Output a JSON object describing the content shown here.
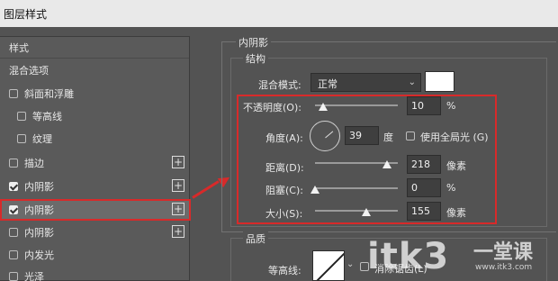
{
  "dialog": {
    "title": "图层样式"
  },
  "styles_list": {
    "header_label": "样式",
    "blend_options_label": "混合选项",
    "items": [
      {
        "label": "斜面和浮雕",
        "checked": false,
        "indent": false,
        "has_plus": false
      },
      {
        "label": "等高线",
        "checked": false,
        "indent": true,
        "has_plus": false
      },
      {
        "label": "纹理",
        "checked": false,
        "indent": true,
        "has_plus": false
      },
      {
        "label": "描边",
        "checked": false,
        "indent": false,
        "has_plus": true
      },
      {
        "label": "内阴影",
        "checked": true,
        "indent": false,
        "has_plus": true
      },
      {
        "label": "内阴影",
        "checked": true,
        "indent": false,
        "has_plus": true,
        "selected": true
      },
      {
        "label": "内阴影",
        "checked": false,
        "indent": false,
        "has_plus": true
      },
      {
        "label": "内发光",
        "checked": false,
        "indent": false,
        "has_plus": false
      },
      {
        "label": "光泽",
        "checked": false,
        "indent": false,
        "has_plus": false
      }
    ],
    "plus_symbol": "+"
  },
  "inner_shadow": {
    "group_title": "内阴影",
    "structure_title": "结构",
    "blend_mode": {
      "label": "混合模式:",
      "value": "正常",
      "caret": "⌄"
    },
    "color_swatch": "#ffffff",
    "opacity": {
      "label": "不透明度(O):",
      "value": "10",
      "unit": "%",
      "slider_fraction": 0.1
    },
    "angle": {
      "label": "角度(A):",
      "value": "39",
      "unit": "度"
    },
    "global_light": {
      "label": "使用全局光 (G)",
      "checked": false
    },
    "distance": {
      "label": "距离(D):",
      "value": "218",
      "unit": "像素",
      "slider_fraction": 0.87
    },
    "choke": {
      "label": "阻塞(C):",
      "value": "0",
      "unit": "%",
      "slider_fraction": 0.0
    },
    "size": {
      "label": "大小(S):",
      "value": "155",
      "unit": "像素",
      "slider_fraction": 0.62
    }
  },
  "quality": {
    "title": "品质",
    "contour_label": "等高线:",
    "antialias_label": "消除锯齿(L)",
    "antialias_checked": false
  },
  "watermark": {
    "main": "itk3",
    "side": "一堂课",
    "url": "www.itk3.com"
  },
  "colors": {
    "highlight_red": "#d82a2a",
    "panel_bg": "#535353",
    "field_bg": "#3f3f3f"
  }
}
